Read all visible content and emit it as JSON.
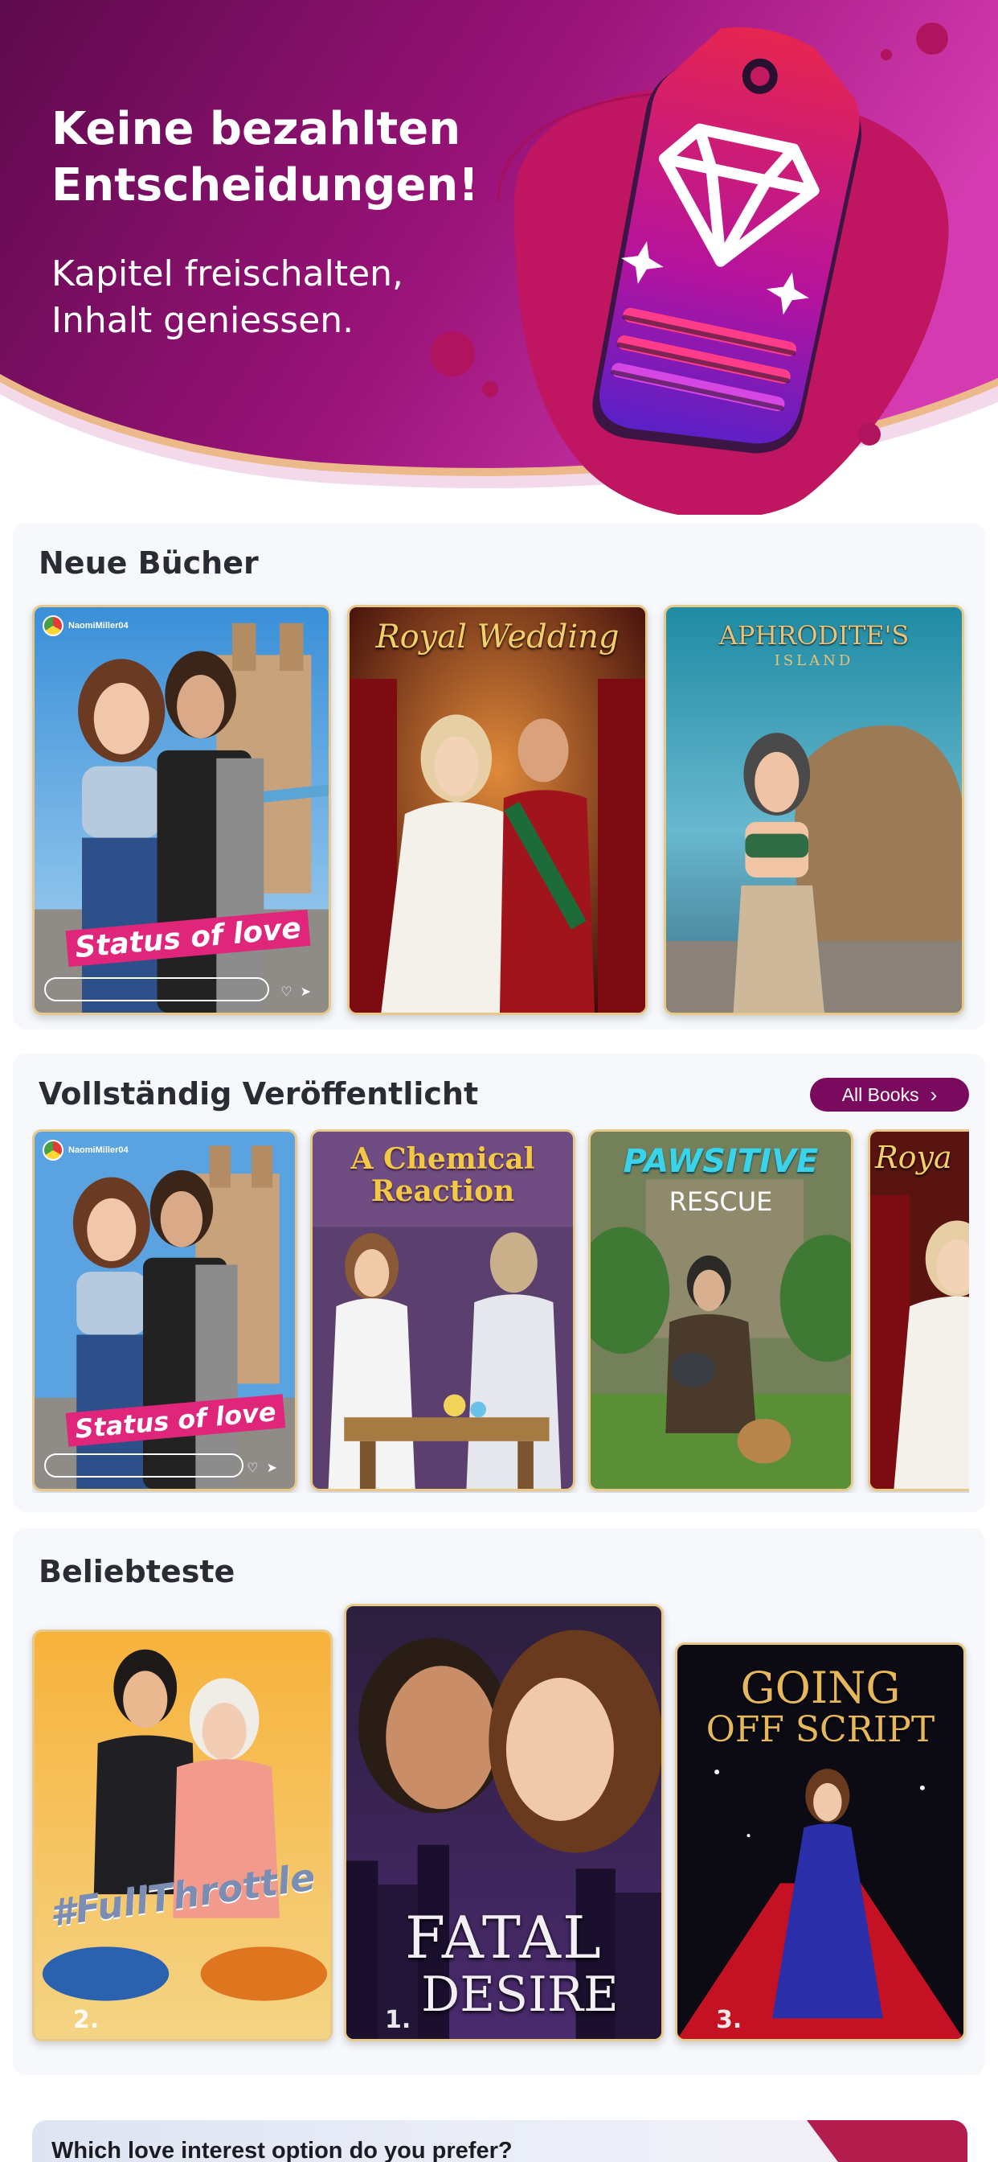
{
  "hero": {
    "title": "Keine bezahlten Entscheidungen!",
    "subtitle": "Kapitel freischalten, Inhalt geniessen.",
    "icon": "diamond-price-tag-icon",
    "colors": {
      "primary": "#8e1170",
      "accent": "#e0267a"
    }
  },
  "sections": {
    "new_books": {
      "title": "Neue Bücher",
      "books": [
        {
          "title": "Status of love",
          "author": "NaomiMiller04"
        },
        {
          "title": "Royal Wedding"
        },
        {
          "title": "APHRODITE'S",
          "subtitle": "ISLAND"
        }
      ]
    },
    "completed": {
      "title": "Vollständig Veröffentlicht",
      "all_books_label": "All Books",
      "books": [
        {
          "title": "Status of love",
          "author": "NaomiMiller04"
        },
        {
          "title": "A Chemical Reaction"
        },
        {
          "title": "PAWSITIVE",
          "subtitle": "RESCUE"
        },
        {
          "title": "Roya"
        }
      ]
    },
    "popular": {
      "title": "Beliebteste",
      "books": [
        {
          "title": "#FullThrottle",
          "rank": "2."
        },
        {
          "title": "FATAL",
          "subtitle": "DESIRE",
          "rank": "1."
        },
        {
          "title": "GOING",
          "subtitle": "OFF SCRIPT",
          "rank": "3."
        }
      ]
    }
  },
  "poll": {
    "question": "Which love interest option do you prefer?"
  }
}
